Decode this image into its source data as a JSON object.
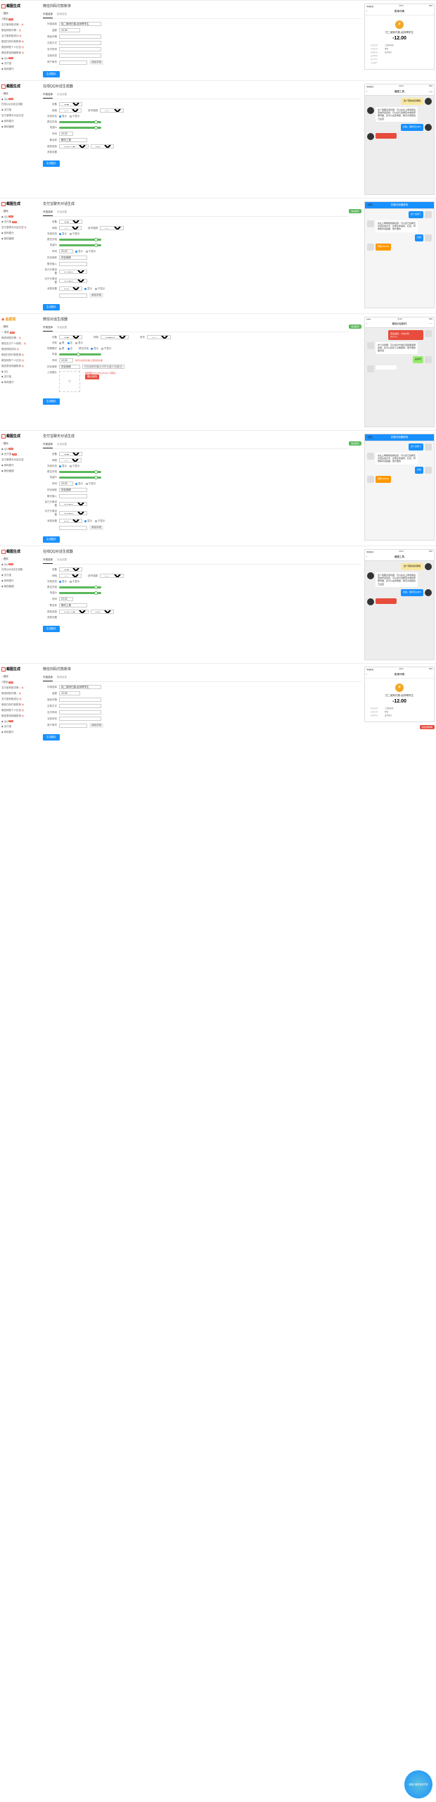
{
  "brand1": {
    "name": "截图生成"
  },
  "brand2": {
    "name": "金庭瑶"
  },
  "nav": {
    "home": "首页",
    "items": [
      {
        "label": "支付宝转账详情",
        "hot": "！热"
      },
      {
        "label": "微信转账详情",
        "hot": "！热"
      },
      {
        "label": "支付宝转账成功",
        "hot": "热"
      },
      {
        "label": "微信扫码付款账单",
        "hot": "热"
      },
      {
        "label": "微信转账个人红包",
        "hot": "热"
      },
      {
        "label": "微信零钱明细账单",
        "hot": "热"
      }
    ],
    "qq": {
      "label": "QQ",
      "badge": "New"
    },
    "alipay": "支付宝",
    "bank": "网商银行",
    "wechat_items": [
      "微信",
      "微信转账详情",
      "微信支付个人转账",
      "微信转账成功",
      "微信扫码付款账单",
      "微信转账个人红包",
      "微信零钱明细账单"
    ],
    "nav_set2": [
      "首页",
      "QQ",
      "在线QQ对话生成器",
      "支付宝",
      "支付宝聊天对话生成",
      "网商银行",
      "微信截图"
    ],
    "nav_set3": [
      "首页",
      "QQ",
      "支付宝",
      "网商银行",
      "微信截图"
    ]
  },
  "mod1": {
    "title": "微信扫码付款账单",
    "tabs": [
      "外观选择",
      "账单信息"
    ],
    "form": {
      "theme": "外观选择",
      "theme_val": "经二维码扫描-赵帅哥学生",
      "amount": "金额",
      "amount_val": "12.00",
      "status": "商品详情",
      "status_val": "",
      "method": "交易方式",
      "method_val": "",
      "time": "支付时间",
      "balance": "当前状态",
      "order": "商户单号"
    },
    "btn_add": "添加字段",
    "btn_gen": "生成图片",
    "preview": {
      "time": "10:41",
      "battery": "52%",
      "signal": "中国联通",
      "header": "账单详情",
      "shop": "扫二维码付款-赵帅哥学生",
      "amount": "-12.00",
      "rows": [
        {
          "k": "商品详情",
          "v": "二维码收款"
        },
        {
          "k": "交易方式",
          "v": "零钱"
        },
        {
          "k": "当前状态",
          "v": "支付成功"
        },
        {
          "k": "支付时间",
          "v": ""
        },
        {
          "k": "商户单号",
          "v": ""
        },
        {
          "k": "对方账户",
          "v": ""
        }
      ]
    }
  },
  "mod2": {
    "title": "在线QQ对话生成器",
    "tabs": [
      "外观选择",
      "对话设置"
    ],
    "form": {
      "device": "设备",
      "device_val": "苹果",
      "net": "网络",
      "net_opts": [
        "Wifi"
      ],
      "signal": "信号强弱",
      "signal_val": "80%",
      "battery": "充电状态",
      "battery_opts": [
        "显示",
        "不显示"
      ],
      "power": "是否充电",
      "power_pct": "电量%",
      "time": "时间",
      "time_val": "22:22",
      "name": "群名称",
      "name_val": "聊天工具",
      "type": "类型选择",
      "type_opts": [
        "手机QQ群",
        "好友"
      ],
      "tone": "消息设置"
    },
    "btn_gen": "生成图片",
    "preview": {
      "status_l": "中国移动",
      "status_time": "22:22",
      "status_r": "50%",
      "header": "截图工具",
      "online": "在线",
      "msgs": [
        {
          "side": "right",
          "type": "yellow",
          "text": "这个真的太好用啦"
        },
        {
          "side": "left",
          "type": "white",
          "text": "这个截图对话功能，可以在左上角选择设置信号运营商，可以自行选择安卓或者苹果界面，还可以设置电量，聊天对话框自己设置"
        },
        {
          "side": "right",
          "type": "blue",
          "text": "好的，随时可以DIY"
        },
        {
          "side": "left",
          "type": "red",
          "text": ""
        }
      ]
    }
  },
  "mod3": {
    "title": "支付宝聊天对话生成",
    "tabs": [
      "外观选择",
      "对话设置"
    ],
    "form": {
      "device": "设备",
      "device_val": "苹果",
      "net": "网络",
      "signal": "信号强弱",
      "signal_val": "80%",
      "battery": "充电状态",
      "battery_opts": [
        "显示",
        "不显示"
      ],
      "power": "是否充电",
      "power_pct": "电量%",
      "time": "时间",
      "time_val": "22:22",
      "name": "好友昵称",
      "name_val": "好友昵称",
      "input": "聊天输入",
      "self_avatar": "自己头像设置",
      "opts": [
        "本地图片"
      ],
      "friend_avatar": "对方头像设置",
      "tone": "消息设置",
      "tone_opts": [
        "文本",
        "显示",
        "不显示"
      ]
    },
    "btn_add": "添加字段",
    "btn_gen": "生成图片",
    "online": "消息聊天",
    "preview": {
      "header": "在聊天标题修改",
      "msgs": [
        {
          "side": "right",
          "text": "这个太棒了"
        },
        {
          "side": "left",
          "text": "在左上角能够选择设置，可以自己在聊天对话生成文字，还能生成语音、红包、转账等对话截图，很方便的"
        },
        {
          "side": "right",
          "text": "好的"
        },
        {
          "side": "left",
          "type": "transfer",
          "text": "转账 200.00"
        }
      ]
    }
  },
  "mod4": {
    "title": "微信对话生成器",
    "tabs": [
      "外观选择",
      "对话设置"
    ],
    "form": {
      "device": "设备",
      "net": "网络",
      "net_val": "中国移动",
      "sig": "信号",
      "sig_val": "80%",
      "disturb": "勿扰",
      "disturb_opts": [
        "是",
        "否",
        "显示"
      ],
      "phone": "听筒模式",
      "phone_opts": [
        "是",
        "否"
      ],
      "charge": "是否充电",
      "charge_opts": [
        "显示",
        "不显示"
      ],
      "power": "电量",
      "time": "时间",
      "time_val": "12:20",
      "hint": "你可以给双方换上真实的头像",
      "name": "好友昵称",
      "name_val": "好友昵称的最大字符长度20位超出显示人数",
      "upload": "上传图片",
      "upload_hint": "推荐图片尺寸640x400(大小限制)",
      "btn_confirm": "确认修改"
    },
    "btn_gen": "生成图片",
    "preview": {
      "header": "微信对话制作",
      "envelope": "微信红包",
      "env_sub": "恭喜发财，大吉大利",
      "msgs": [
        {
          "side": "left",
          "text": "这个好用啊，可以给对方发红包截图发朋友圈，还可以自定义头像昵称，很方便的做对话"
        },
        {
          "side": "right",
          "text": "是的呀"
        }
      ]
    }
  },
  "mod5": {
    "title": "支付宝聊天对话生成",
    "preview_header": "在聊天标题修改"
  },
  "mod6": {
    "title": "在线QQ对话生成器"
  },
  "mod7": {
    "title": "微信扫码付款账单"
  },
  "watermark": "截图小程序免费开源"
}
